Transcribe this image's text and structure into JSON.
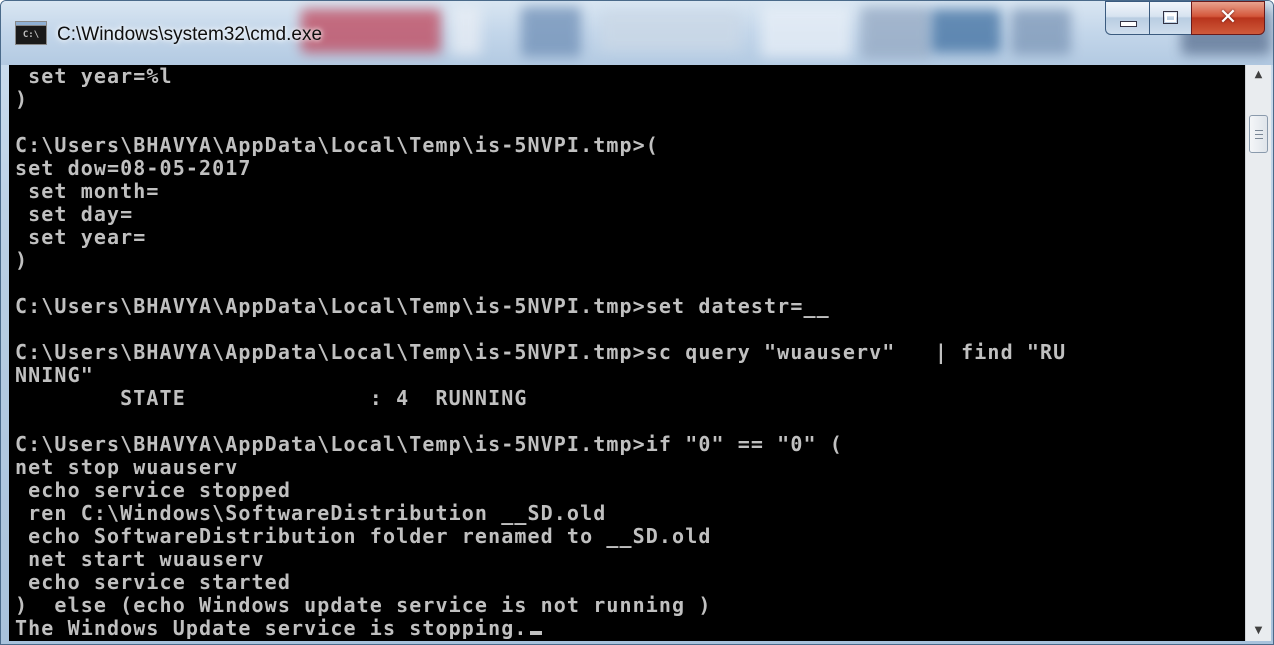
{
  "window": {
    "title": "C:\\Windows\\system32\\cmd.exe",
    "icon_text": "C:\\",
    "close_glyph": "✕"
  },
  "console": {
    "lines": [
      " set year=%l",
      ")",
      "",
      "C:\\Users\\BHAVYA\\AppData\\Local\\Temp\\is-5NVPI.tmp>(",
      "set dow=08-05-2017",
      " set month=",
      " set day=",
      " set year=",
      ")",
      "",
      "C:\\Users\\BHAVYA\\AppData\\Local\\Temp\\is-5NVPI.tmp>set datestr=__",
      "",
      "C:\\Users\\BHAVYA\\AppData\\Local\\Temp\\is-5NVPI.tmp>sc query \"wuauserv\"   | find \"RU",
      "NNING\"",
      "        STATE              : 4  RUNNING",
      "",
      "C:\\Users\\BHAVYA\\AppData\\Local\\Temp\\is-5NVPI.tmp>if \"0\" == \"0\" (",
      "net stop wuauserv",
      " echo service stopped",
      " ren C:\\Windows\\SoftwareDistribution __SD.old",
      " echo SoftwareDistribution folder renamed to __SD.old",
      " net start wuauserv",
      " echo service started",
      ")  else (echo Windows update service is not running )",
      "The Windows Update service is stopping."
    ]
  },
  "scrollbar": {
    "up_arrow": "▲",
    "down_arrow": "▼"
  },
  "colors": {
    "console_bg": "#000000",
    "console_fg": "#c0c0c0",
    "close_button": "#c8452a"
  }
}
